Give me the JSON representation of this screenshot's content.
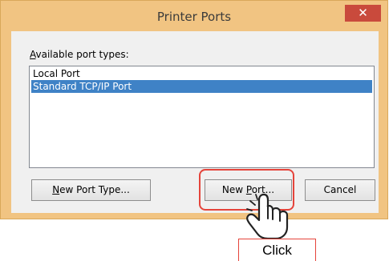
{
  "window": {
    "title": "Printer Ports",
    "close_glyph": "✕"
  },
  "port_list": {
    "label_prefix": "",
    "label_accel": "A",
    "label_rest": "vailable port types:",
    "items": [
      {
        "label": "Local Port",
        "selected": false
      },
      {
        "label": "Standard TCP/IP Port",
        "selected": true
      }
    ]
  },
  "buttons": {
    "new_port_type": {
      "accel": "N",
      "rest": "ew Port Type..."
    },
    "new_port": {
      "prefix": "New ",
      "accel": "P",
      "rest": "ort..."
    },
    "cancel": {
      "label": "Cancel"
    }
  },
  "annotation": {
    "callout_text": "Click"
  },
  "colors": {
    "window_frame": "#f1c482",
    "close_button": "#c94a3c",
    "selection": "#3f82c6",
    "highlight": "#e5443b"
  }
}
